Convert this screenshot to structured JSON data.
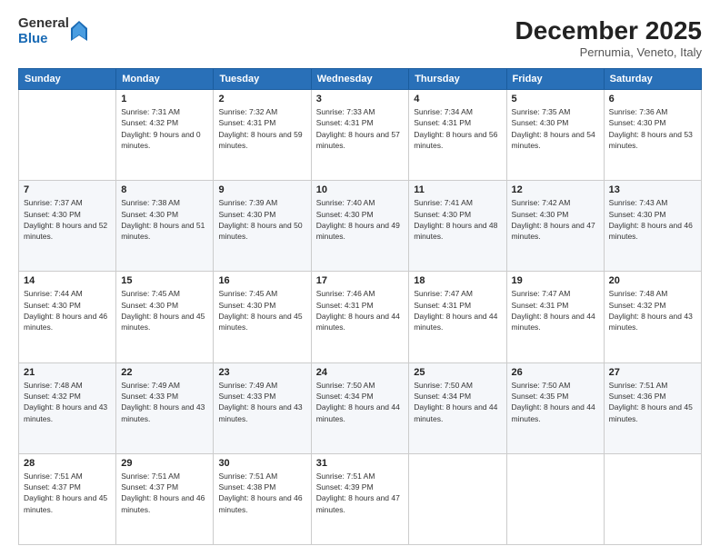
{
  "logo": {
    "general": "General",
    "blue": "Blue"
  },
  "header": {
    "month": "December 2025",
    "location": "Pernumia, Veneto, Italy"
  },
  "weekdays": [
    "Sunday",
    "Monday",
    "Tuesday",
    "Wednesday",
    "Thursday",
    "Friday",
    "Saturday"
  ],
  "weeks": [
    [
      {
        "day": "",
        "sunrise": "",
        "sunset": "",
        "daylight": ""
      },
      {
        "day": "1",
        "sunrise": "Sunrise: 7:31 AM",
        "sunset": "Sunset: 4:32 PM",
        "daylight": "Daylight: 9 hours and 0 minutes."
      },
      {
        "day": "2",
        "sunrise": "Sunrise: 7:32 AM",
        "sunset": "Sunset: 4:31 PM",
        "daylight": "Daylight: 8 hours and 59 minutes."
      },
      {
        "day": "3",
        "sunrise": "Sunrise: 7:33 AM",
        "sunset": "Sunset: 4:31 PM",
        "daylight": "Daylight: 8 hours and 57 minutes."
      },
      {
        "day": "4",
        "sunrise": "Sunrise: 7:34 AM",
        "sunset": "Sunset: 4:31 PM",
        "daylight": "Daylight: 8 hours and 56 minutes."
      },
      {
        "day": "5",
        "sunrise": "Sunrise: 7:35 AM",
        "sunset": "Sunset: 4:30 PM",
        "daylight": "Daylight: 8 hours and 54 minutes."
      },
      {
        "day": "6",
        "sunrise": "Sunrise: 7:36 AM",
        "sunset": "Sunset: 4:30 PM",
        "daylight": "Daylight: 8 hours and 53 minutes."
      }
    ],
    [
      {
        "day": "7",
        "sunrise": "Sunrise: 7:37 AM",
        "sunset": "Sunset: 4:30 PM",
        "daylight": "Daylight: 8 hours and 52 minutes."
      },
      {
        "day": "8",
        "sunrise": "Sunrise: 7:38 AM",
        "sunset": "Sunset: 4:30 PM",
        "daylight": "Daylight: 8 hours and 51 minutes."
      },
      {
        "day": "9",
        "sunrise": "Sunrise: 7:39 AM",
        "sunset": "Sunset: 4:30 PM",
        "daylight": "Daylight: 8 hours and 50 minutes."
      },
      {
        "day": "10",
        "sunrise": "Sunrise: 7:40 AM",
        "sunset": "Sunset: 4:30 PM",
        "daylight": "Daylight: 8 hours and 49 minutes."
      },
      {
        "day": "11",
        "sunrise": "Sunrise: 7:41 AM",
        "sunset": "Sunset: 4:30 PM",
        "daylight": "Daylight: 8 hours and 48 minutes."
      },
      {
        "day": "12",
        "sunrise": "Sunrise: 7:42 AM",
        "sunset": "Sunset: 4:30 PM",
        "daylight": "Daylight: 8 hours and 47 minutes."
      },
      {
        "day": "13",
        "sunrise": "Sunrise: 7:43 AM",
        "sunset": "Sunset: 4:30 PM",
        "daylight": "Daylight: 8 hours and 46 minutes."
      }
    ],
    [
      {
        "day": "14",
        "sunrise": "Sunrise: 7:44 AM",
        "sunset": "Sunset: 4:30 PM",
        "daylight": "Daylight: 8 hours and 46 minutes."
      },
      {
        "day": "15",
        "sunrise": "Sunrise: 7:45 AM",
        "sunset": "Sunset: 4:30 PM",
        "daylight": "Daylight: 8 hours and 45 minutes."
      },
      {
        "day": "16",
        "sunrise": "Sunrise: 7:45 AM",
        "sunset": "Sunset: 4:30 PM",
        "daylight": "Daylight: 8 hours and 45 minutes."
      },
      {
        "day": "17",
        "sunrise": "Sunrise: 7:46 AM",
        "sunset": "Sunset: 4:31 PM",
        "daylight": "Daylight: 8 hours and 44 minutes."
      },
      {
        "day": "18",
        "sunrise": "Sunrise: 7:47 AM",
        "sunset": "Sunset: 4:31 PM",
        "daylight": "Daylight: 8 hours and 44 minutes."
      },
      {
        "day": "19",
        "sunrise": "Sunrise: 7:47 AM",
        "sunset": "Sunset: 4:31 PM",
        "daylight": "Daylight: 8 hours and 44 minutes."
      },
      {
        "day": "20",
        "sunrise": "Sunrise: 7:48 AM",
        "sunset": "Sunset: 4:32 PM",
        "daylight": "Daylight: 8 hours and 43 minutes."
      }
    ],
    [
      {
        "day": "21",
        "sunrise": "Sunrise: 7:48 AM",
        "sunset": "Sunset: 4:32 PM",
        "daylight": "Daylight: 8 hours and 43 minutes."
      },
      {
        "day": "22",
        "sunrise": "Sunrise: 7:49 AM",
        "sunset": "Sunset: 4:33 PM",
        "daylight": "Daylight: 8 hours and 43 minutes."
      },
      {
        "day": "23",
        "sunrise": "Sunrise: 7:49 AM",
        "sunset": "Sunset: 4:33 PM",
        "daylight": "Daylight: 8 hours and 43 minutes."
      },
      {
        "day": "24",
        "sunrise": "Sunrise: 7:50 AM",
        "sunset": "Sunset: 4:34 PM",
        "daylight": "Daylight: 8 hours and 44 minutes."
      },
      {
        "day": "25",
        "sunrise": "Sunrise: 7:50 AM",
        "sunset": "Sunset: 4:34 PM",
        "daylight": "Daylight: 8 hours and 44 minutes."
      },
      {
        "day": "26",
        "sunrise": "Sunrise: 7:50 AM",
        "sunset": "Sunset: 4:35 PM",
        "daylight": "Daylight: 8 hours and 44 minutes."
      },
      {
        "day": "27",
        "sunrise": "Sunrise: 7:51 AM",
        "sunset": "Sunset: 4:36 PM",
        "daylight": "Daylight: 8 hours and 45 minutes."
      }
    ],
    [
      {
        "day": "28",
        "sunrise": "Sunrise: 7:51 AM",
        "sunset": "Sunset: 4:37 PM",
        "daylight": "Daylight: 8 hours and 45 minutes."
      },
      {
        "day": "29",
        "sunrise": "Sunrise: 7:51 AM",
        "sunset": "Sunset: 4:37 PM",
        "daylight": "Daylight: 8 hours and 46 minutes."
      },
      {
        "day": "30",
        "sunrise": "Sunrise: 7:51 AM",
        "sunset": "Sunset: 4:38 PM",
        "daylight": "Daylight: 8 hours and 46 minutes."
      },
      {
        "day": "31",
        "sunrise": "Sunrise: 7:51 AM",
        "sunset": "Sunset: 4:39 PM",
        "daylight": "Daylight: 8 hours and 47 minutes."
      },
      {
        "day": "",
        "sunrise": "",
        "sunset": "",
        "daylight": ""
      },
      {
        "day": "",
        "sunrise": "",
        "sunset": "",
        "daylight": ""
      },
      {
        "day": "",
        "sunrise": "",
        "sunset": "",
        "daylight": ""
      }
    ]
  ]
}
